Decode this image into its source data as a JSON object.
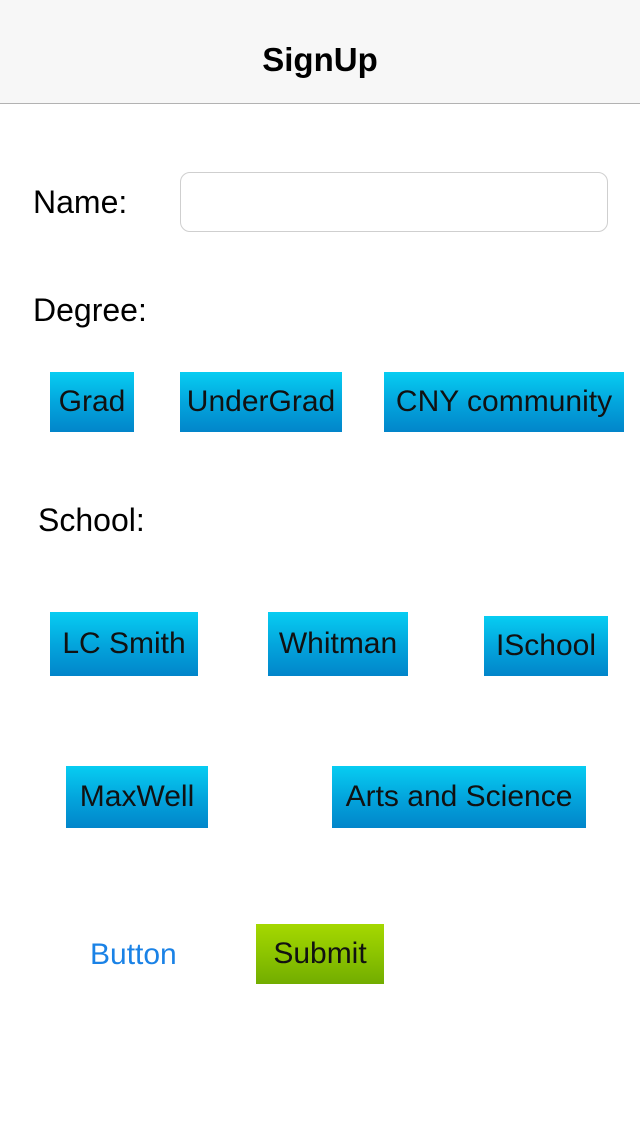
{
  "nav": {
    "title": "SignUp"
  },
  "form": {
    "name_label": "Name:",
    "name_value": "",
    "name_placeholder": "",
    "degree_label": "Degree:",
    "school_label": "School:"
  },
  "degree_buttons": {
    "grad": "Grad",
    "undergrad": "UnderGrad",
    "cny": "CNY community"
  },
  "school_buttons": {
    "lc_smith": "LC Smith",
    "whitman": "Whitman",
    "ischool": "ISchool",
    "maxwell": "MaxWell",
    "arts_science": "Arts and Science"
  },
  "actions": {
    "button_label": "Button",
    "submit_label": "Submit"
  },
  "colors": {
    "button_blue": "#03a6dd",
    "submit_green": "#8cc400",
    "link_blue": "#1a82e6"
  }
}
